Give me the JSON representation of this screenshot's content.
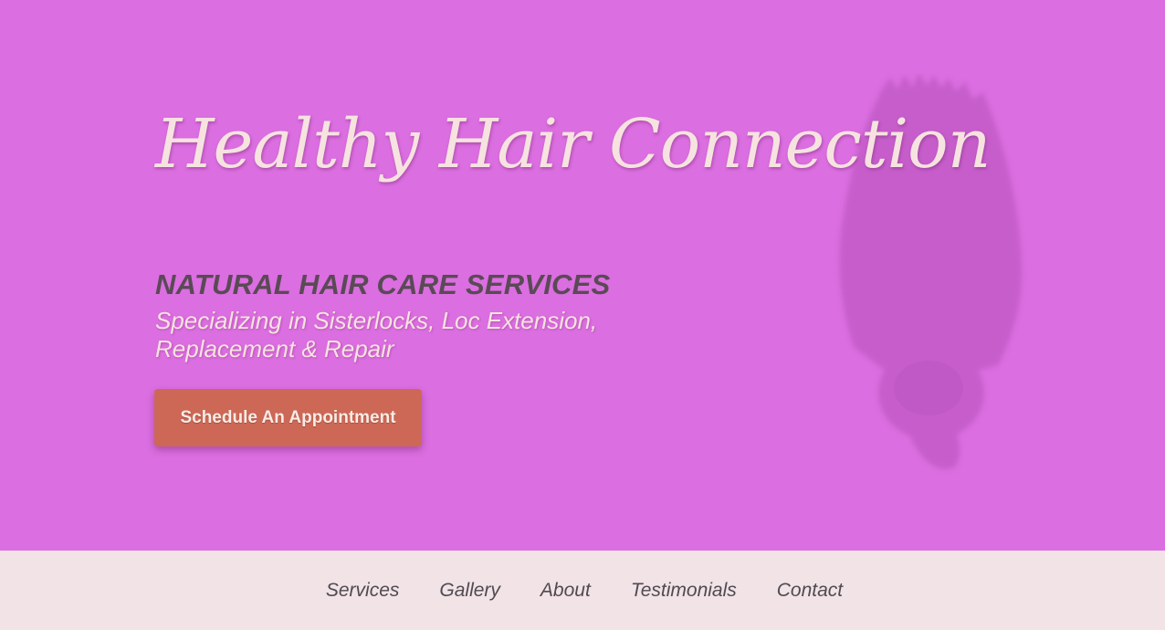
{
  "hero": {
    "brand_title": "Healthy Hair Connection",
    "headline": "NATURAL HAIR CARE SERVICES",
    "subheadline": "Specializing in Sisterlocks, Loc Extension, Replacement & Repair",
    "cta_label": "Schedule An Appointment",
    "background_color": "#db6ee0",
    "button_color": "#cd6856"
  },
  "nav": {
    "items": [
      {
        "label": "Services"
      },
      {
        "label": "Gallery"
      },
      {
        "label": "About"
      },
      {
        "label": "Testimonials"
      },
      {
        "label": "Contact"
      }
    ]
  }
}
